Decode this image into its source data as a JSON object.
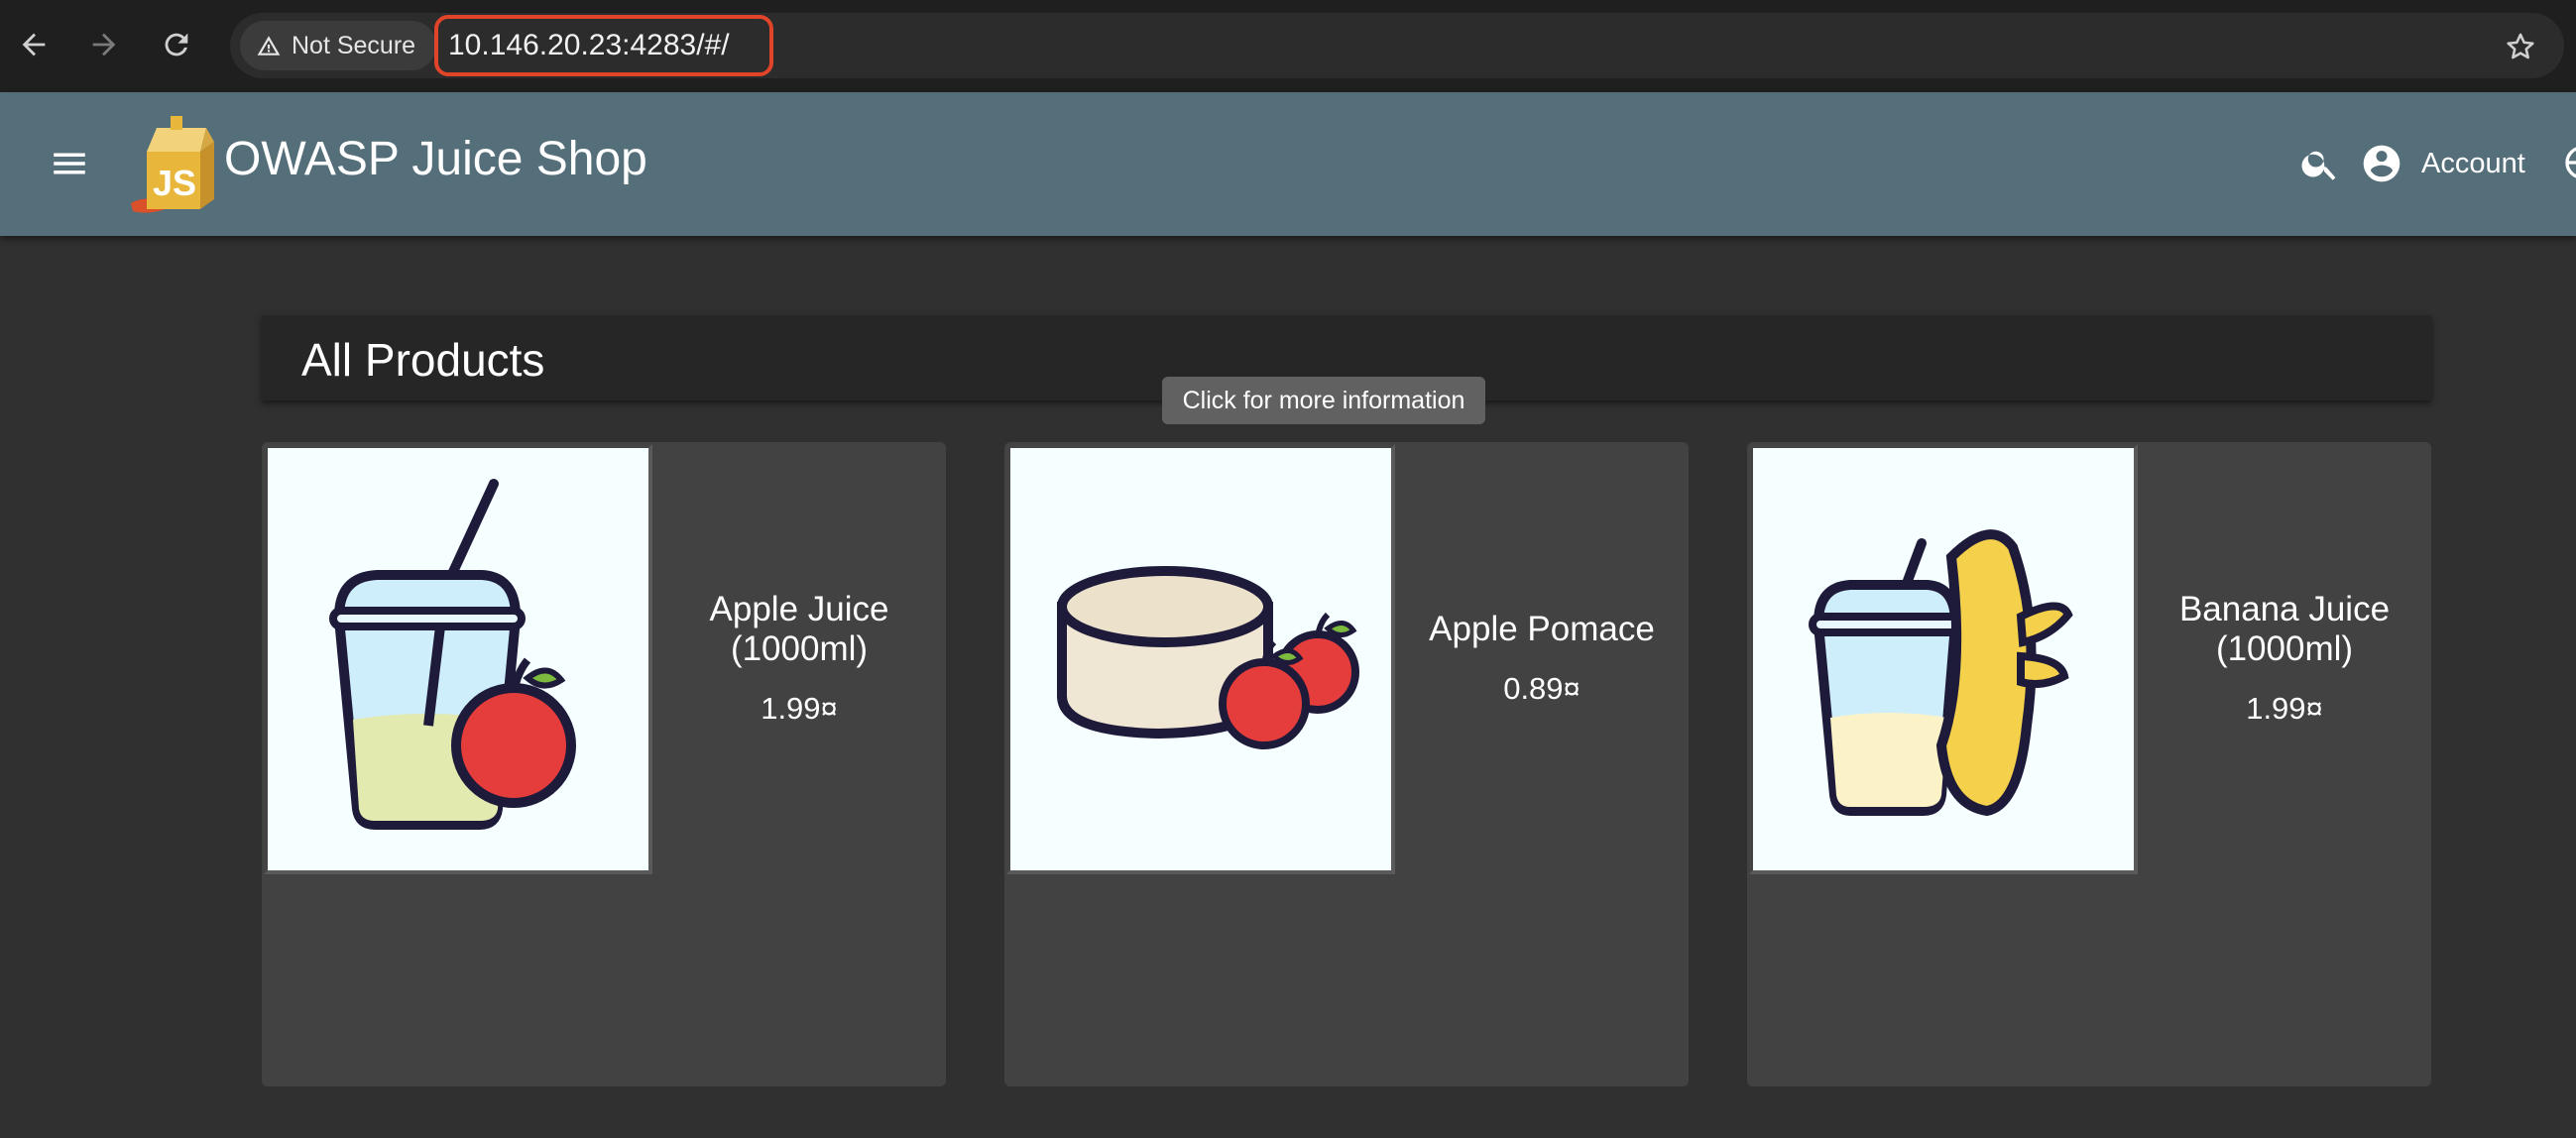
{
  "browser": {
    "security_label": "Not Secure",
    "url": "10.146.20.23:4283/#/",
    "icons": [
      "back-arrow-icon",
      "forward-arrow-icon",
      "reload-icon",
      "warning-icon",
      "star-icon"
    ]
  },
  "app": {
    "title": "OWASP Juice Shop",
    "account_label": "Account",
    "toolbar_color": "#546e7a",
    "icons": [
      "menu-icon",
      "juice-shop-logo",
      "search-icon",
      "account-circle-icon",
      "language-icon"
    ]
  },
  "main": {
    "heading": "All Products",
    "tooltip": "Click for more information",
    "products": [
      {
        "name": "Apple Juice (1000ml)",
        "price": "1.99¤",
        "image": "apple-juice-icon"
      },
      {
        "name": "Apple Pomace",
        "price": "0.89¤",
        "image": "apple-pomace-icon"
      },
      {
        "name": "Banana Juice (1000ml)",
        "price": "1.99¤",
        "image": "banana-juice-icon"
      }
    ]
  }
}
